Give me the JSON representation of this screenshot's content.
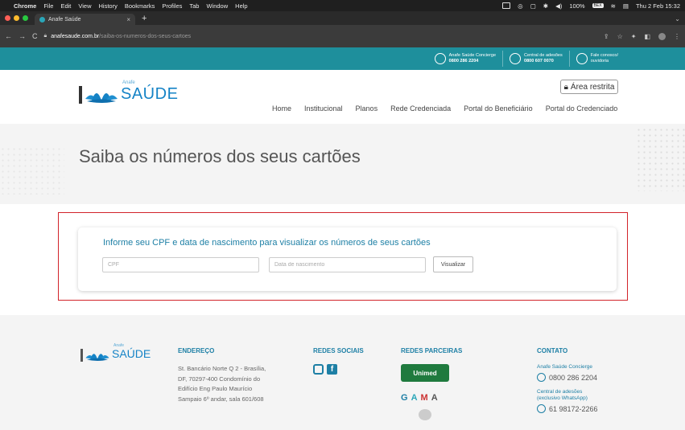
{
  "macbar": {
    "app": "Chrome",
    "menus": [
      "File",
      "Edit",
      "View",
      "History",
      "Bookmarks",
      "Profiles",
      "Tab",
      "Window",
      "Help"
    ],
    "battery": "100%",
    "battery_badge": "BEX",
    "datetime": "Thu 2 Feb 15:32"
  },
  "tab": {
    "title": "Anafe Saúde"
  },
  "address": {
    "domain": "anafesaude.com.br",
    "path": "/saiba-os-numeros-dos-seus-cartoes"
  },
  "topstrip": {
    "concierge_label": "Anafe Saúde Concierge",
    "concierge_number": "0800 286 2204",
    "adesoes_label": "Central de adesões",
    "adesoes_number": "0800 607 0070",
    "fale_label": "Fale conosco/",
    "fale_sub": "ouvidoria"
  },
  "header": {
    "logo_small": "Anafe",
    "logo_big": "SAÚDE",
    "area_restrita": "Área restrita",
    "menu": [
      "Home",
      "Institucional",
      "Planos",
      "Rede Credenciada",
      "Portal do Beneficiário",
      "Portal do Credenciado"
    ]
  },
  "banner": {
    "title": "Saiba os números dos seus cartões"
  },
  "form": {
    "heading": "Informe seu CPF e data de nascimento para visualizar os números de seus cartões",
    "cpf_placeholder": "CPF",
    "dob_placeholder": "Data de nascimento",
    "button": "Visualizar"
  },
  "footer": {
    "logo_small": "Anafe",
    "logo_big": "SAÚDE",
    "endereco_title": "ENDEREÇO",
    "endereco_text": "St. Bancário Norte Q 2 - Brasília, DF, 70297-400 Condomínio do Edifício Eng Paulo Maurício Sampaio 6º andar, sala 601/608",
    "redes_title": "REDES SOCIAIS",
    "parceiras_title": "REDES PARCEIRAS",
    "unimed": "Unimed",
    "gama": [
      "G",
      "A",
      "M",
      "A"
    ],
    "contato_title": "CONTATO",
    "concierge_label": "Anafe Saúde Concierge",
    "concierge_number": "0800 286 2204",
    "adesoes_label1": "Central de adesões",
    "adesoes_label2": "(exclusivo WhatsApp)",
    "whatsapp_number": "61 98172-2266"
  }
}
